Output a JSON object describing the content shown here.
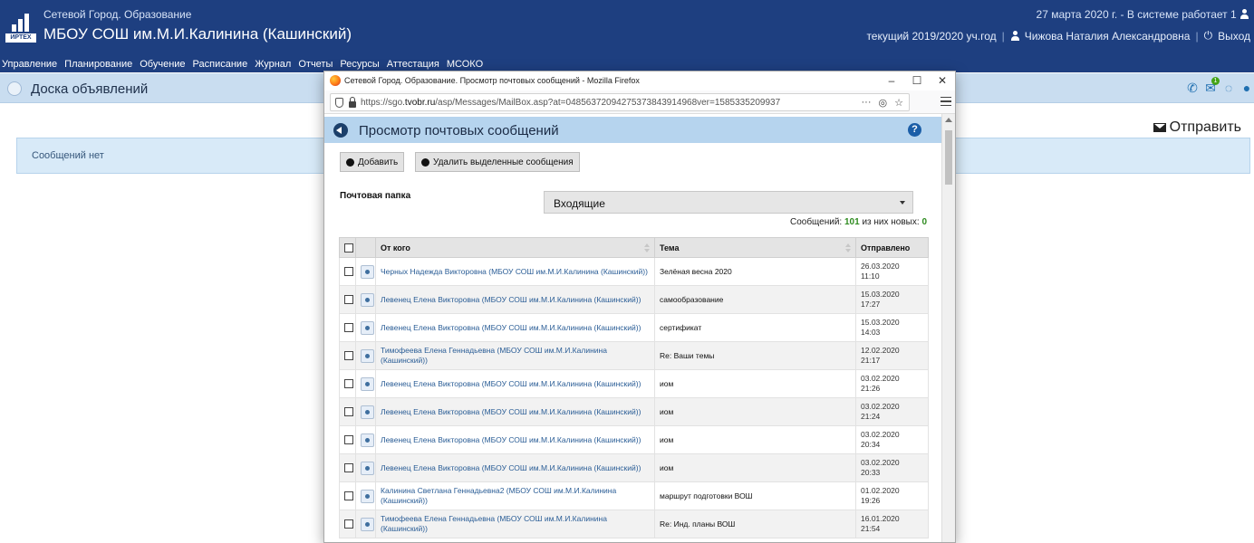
{
  "site": {
    "logo_text": "ИРТЕХ",
    "subtitle": "Сетевой Город. Образование",
    "title": "МБОУ СОШ им.М.И.Калинина (Кашинский)",
    "date_text": "27 марта 2020 г. - В системе работает 1",
    "year": "текущий 2019/2020 уч.год",
    "user": "Чижова Наталия Александровна",
    "logout": "Выход"
  },
  "nav": [
    "Управление",
    "Планирование",
    "Обучение",
    "Расписание",
    "Журнал",
    "Отчеты",
    "Ресурсы",
    "Аттестация",
    "МСОКО"
  ],
  "page": {
    "title": "Доска объявлений",
    "send_label": "Отправить",
    "notice": "Сообщений нет",
    "badge_count": "1"
  },
  "popup": {
    "window_title": "Сетевой Город. Образование. Просмотр почтовых сообщений - Mozilla Firefox",
    "url_prefix": "https://sgo.",
    "url_domain": "tvobr.ru",
    "url_suffix": "/asp/Messages/MailBox.asp?at=04856372094275373843914968ver=1585335209937",
    "url_more": "···",
    "heading": "Просмотр почтовых сообщений",
    "help": "?",
    "add_btn": "Добавить",
    "delete_btn": "Удалить выделенные сообщения",
    "folder_label": "Почтовая папка",
    "folder_value": "Входящие",
    "count_label": "Сообщений:",
    "count_total": "101",
    "count_new_label": "из них новых:",
    "count_new": "0",
    "columns": {
      "from": "От кого",
      "subject": "Тема",
      "sent": "Отправлено"
    },
    "rows": [
      {
        "from": "Черных Надежда Викторовна (МБОУ СОШ им.М.И.Калинина (Кашинский))",
        "subject": "Зелёная весна 2020",
        "date": "26.03.2020",
        "time": "11:10"
      },
      {
        "from": "Левенец Елена Викторовна (МБОУ СОШ им.М.И.Калинина (Кашинский))",
        "subject": "самообразование",
        "date": "15.03.2020",
        "time": "17:27"
      },
      {
        "from": "Левенец Елена Викторовна (МБОУ СОШ им.М.И.Калинина (Кашинский))",
        "subject": "сертификат",
        "date": "15.03.2020",
        "time": "14:03"
      },
      {
        "from": "Тимофеева Елена Геннадьевна (МБОУ СОШ им.М.И.Калинина (Кашинский))",
        "subject": "Re: Ваши темы",
        "date": "12.02.2020",
        "time": "21:17"
      },
      {
        "from": "Левенец Елена Викторовна (МБОУ СОШ им.М.И.Калинина (Кашинский))",
        "subject": "иом",
        "date": "03.02.2020",
        "time": "21:26"
      },
      {
        "from": "Левенец Елена Викторовна (МБОУ СОШ им.М.И.Калинина (Кашинский))",
        "subject": "иом",
        "date": "03.02.2020",
        "time": "21:24"
      },
      {
        "from": "Левенец Елена Викторовна (МБОУ СОШ им.М.И.Калинина (Кашинский))",
        "subject": "иом",
        "date": "03.02.2020",
        "time": "20:34"
      },
      {
        "from": "Левенец Елена Викторовна (МБОУ СОШ им.М.И.Калинина (Кашинский))",
        "subject": "иом",
        "date": "03.02.2020",
        "time": "20:33"
      },
      {
        "from": "Калинина Светлана Геннадьевна2 (МБОУ СОШ им.М.И.Калинина (Кашинский))",
        "subject": "маршрут подготовки ВОШ",
        "date": "01.02.2020",
        "time": "19:26"
      },
      {
        "from": "Тимофеева Елена Геннадьевна (МБОУ СОШ им.М.И.Калинина (Кашинский))",
        "subject": "Re: Инд. планы ВОШ",
        "date": "16.01.2020",
        "time": "21:54"
      }
    ]
  },
  "colors": {
    "header": "#1e3f80",
    "bar": "#c9ddf0",
    "notice": "#d8eaf8",
    "count_green": "#2e8b1f"
  }
}
